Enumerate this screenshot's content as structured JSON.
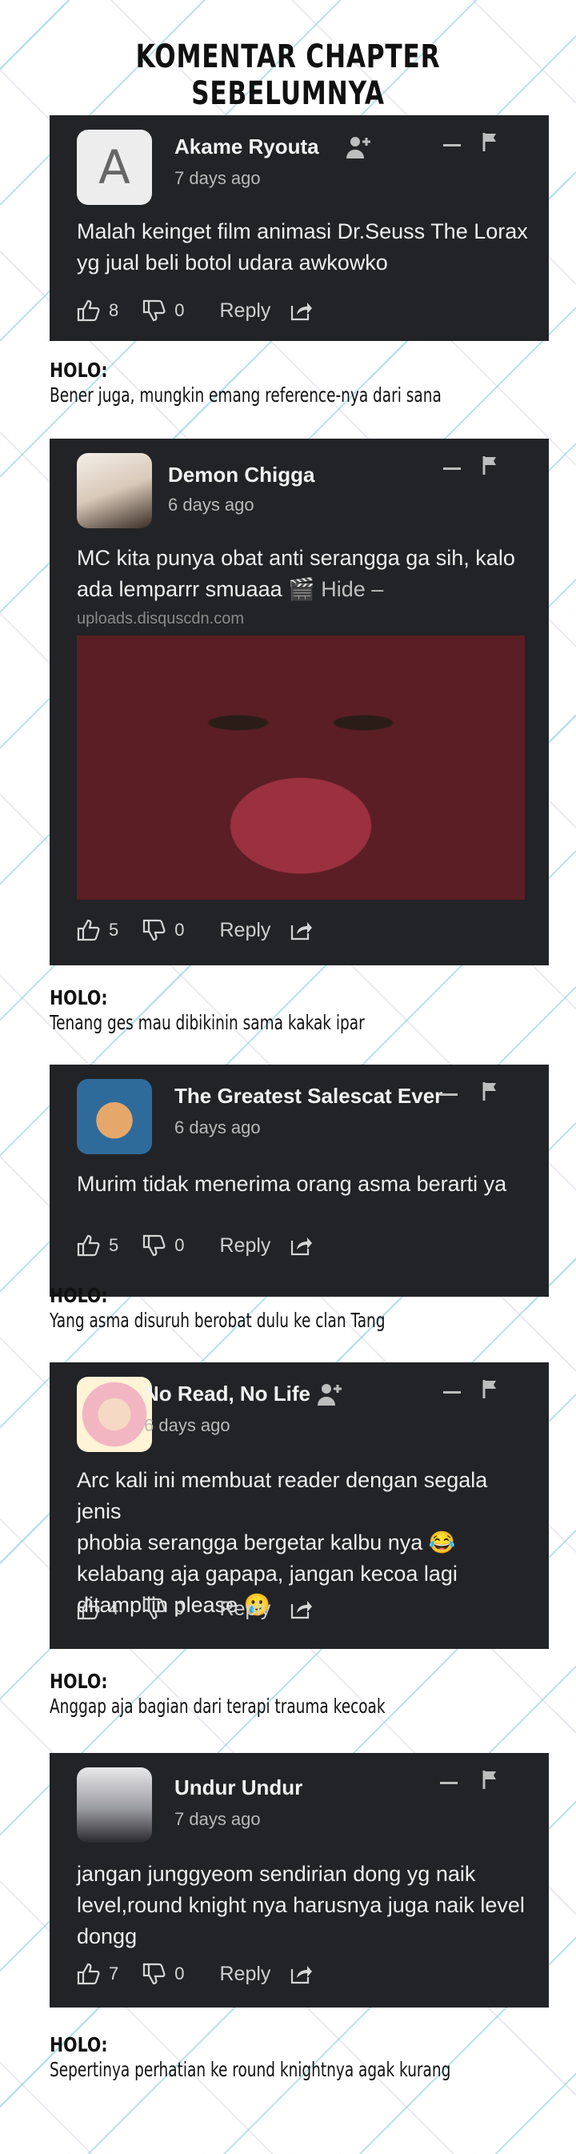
{
  "page": {
    "title": "KOMENTAR CHAPTER SEBELUMNYA"
  },
  "common": {
    "reply_label": "Reply",
    "holo_label": "HOLO:"
  },
  "comments": [
    {
      "author": "Akame Ryouta",
      "avatar_letter": "A",
      "time": "7 days ago",
      "text_lines": [
        "Malah keinget film animasi Dr.Seuss The Lorax",
        "yg jual beli botol udara awkowko"
      ],
      "likes": "8",
      "dislikes": "0",
      "has_follow_icon": true
    },
    {
      "author": "Demon Chigga",
      "time": "6 days ago",
      "text_lines": [
        "MC kita punya obat anti serangga ga sih, kalo",
        "ada lemparrr smuaaa"
      ],
      "hide_text": "Hide –",
      "media_icon": "clapperboard-icon",
      "upload_domain": "uploads.disquscdn.com",
      "likes": "5",
      "dislikes": "0",
      "has_follow_icon": false
    },
    {
      "author": "The Greatest Salescat Ever",
      "time": "6 days ago",
      "text_lines": [
        "Murim tidak menerima orang asma berarti ya"
      ],
      "likes": "5",
      "dislikes": "0",
      "has_follow_icon": false
    },
    {
      "author": "No Read, No Life",
      "time": "6 days ago",
      "text_lines": [
        "Arc kali ini membuat reader dengan segala jenis",
        "phobia serangga bergetar kalbu nya 😂",
        "kelabang aja gapapa, jangan kecoa lagi",
        "ditampilin please 🥲"
      ],
      "likes": "4",
      "dislikes": "0",
      "has_follow_icon": true
    },
    {
      "author": "Undur Undur",
      "time": "7 days ago",
      "text_lines": [
        "jangan junggyeom sendirian dong yg naik",
        "level,round knight nya harusnya juga naik level",
        "dongg"
      ],
      "likes": "7",
      "dislikes": "0",
      "has_follow_icon": false
    }
  ],
  "holo_replies": [
    "Bener juga, mungkin emang reference-nya dari sana",
    "Tenang ges mau dibikinin sama kakak ipar",
    "Yang asma disuruh berobat dulu ke clan Tang",
    "Anggap aja bagian dari terapi trauma kecoak",
    "Sepertinya perhatian ke round knightnya agak kurang"
  ],
  "colors": {
    "card_bg": "#222326",
    "text": "#efefef",
    "muted": "#b9b9b9",
    "pattern_teal": "#78c8cd"
  }
}
